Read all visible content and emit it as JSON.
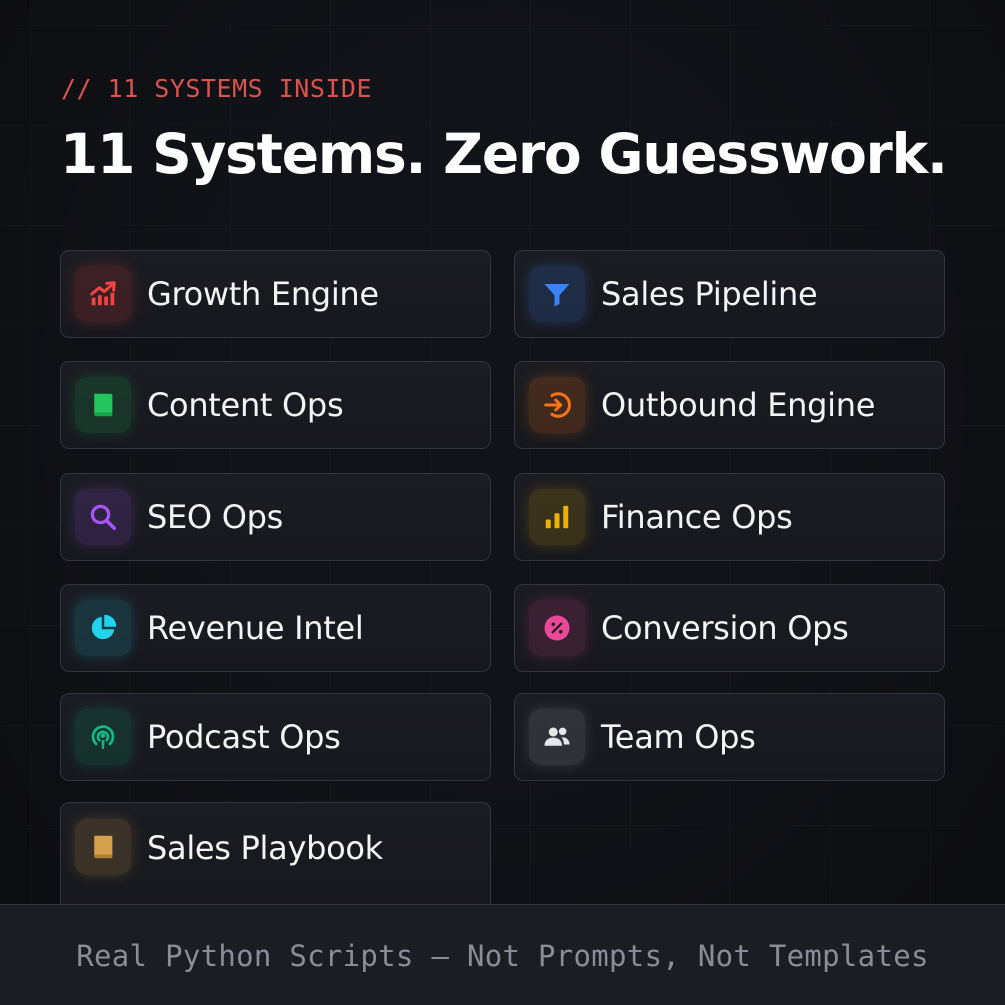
{
  "header": {
    "eyebrow": "// 11 SYSTEMS INSIDE",
    "title": "11 Systems. Zero Guesswork."
  },
  "systems": [
    {
      "label": "Growth Engine",
      "icon": "trending-up-icon",
      "color": "#ef4444"
    },
    {
      "label": "Sales Pipeline",
      "icon": "funnel-icon",
      "color": "#3b82f6"
    },
    {
      "label": "Content Ops",
      "icon": "book-icon",
      "color": "#22c55e"
    },
    {
      "label": "Outbound Engine",
      "icon": "arrow-in-circle-icon",
      "color": "#f97316"
    },
    {
      "label": "SEO Ops",
      "icon": "search-icon",
      "color": "#a855f7"
    },
    {
      "label": "Finance Ops",
      "icon": "bar-chart-icon",
      "color": "#eab308"
    },
    {
      "label": "Revenue Intel",
      "icon": "pie-chart-icon",
      "color": "#22d3ee"
    },
    {
      "label": "Conversion Ops",
      "icon": "percent-icon",
      "color": "#ec4899"
    },
    {
      "label": "Podcast Ops",
      "icon": "podcast-icon",
      "color": "#10b981"
    },
    {
      "label": "Team Ops",
      "icon": "users-icon",
      "color": "#e5e7eb"
    },
    {
      "label": "Sales Playbook",
      "icon": "closed-book-icon",
      "color": "#d4a24c"
    }
  ],
  "footer": {
    "text": "Real Python Scripts — Not Prompts, Not Templates"
  }
}
